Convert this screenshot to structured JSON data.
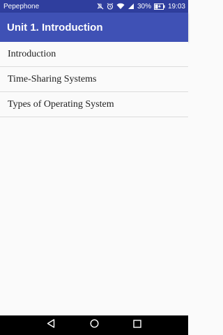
{
  "status_bar": {
    "carrier": "Pepephone",
    "battery_percent": "30%",
    "time": "19:03",
    "icons": [
      "mute-icon",
      "alarm-icon",
      "wifi-icon",
      "signal-icon",
      "battery-charging-icon"
    ]
  },
  "app_bar": {
    "title": "Unit 1. Introduction"
  },
  "list": {
    "items": [
      {
        "label": "Introduction"
      },
      {
        "label": "Time-Sharing Systems"
      },
      {
        "label": "Types of Operating System"
      }
    ]
  },
  "nav_bar": {
    "icons": [
      "back-icon",
      "home-icon",
      "recents-icon"
    ]
  },
  "colors": {
    "status_bar": "#2f3e9e",
    "app_bar": "#3f51b5",
    "background": "#fafafa",
    "nav_bar": "#000000"
  }
}
